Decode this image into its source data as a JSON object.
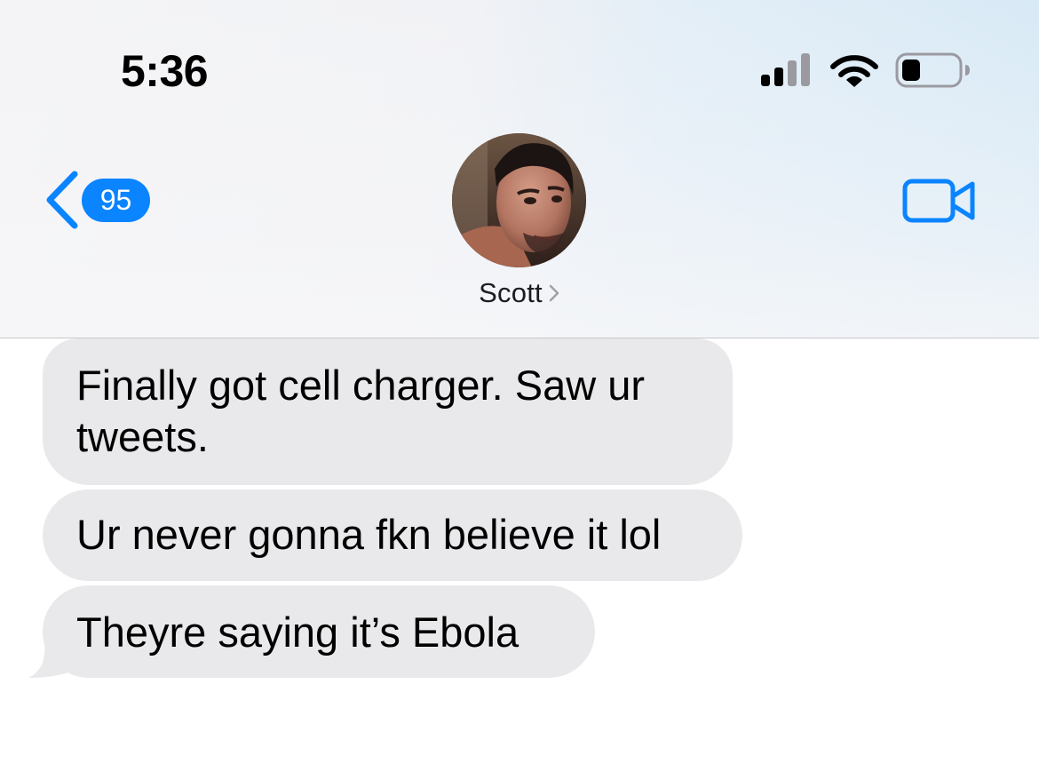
{
  "status_bar": {
    "time": "5:36",
    "icons": [
      "cellular-signal-icon",
      "wifi-icon",
      "battery-icon"
    ]
  },
  "header": {
    "back_badge_count": "95",
    "back_icon": "chevron-left-icon",
    "contact_name": "Scott",
    "contact_chevron_icon": "chevron-right-icon",
    "video_icon": "video-camera-icon"
  },
  "messages": [
    {
      "direction": "incoming",
      "text": "Finally got cell charger. Saw ur tweets."
    },
    {
      "direction": "incoming",
      "text": "Ur never gonna fkn believe it lol"
    },
    {
      "direction": "incoming",
      "text": "Theyre saying it’s Ebola"
    }
  ],
  "colors": {
    "accent": "#0a84ff",
    "incoming_bubble": "#e9e9eb",
    "text": "#000000",
    "divider": "#c7c7cc"
  }
}
